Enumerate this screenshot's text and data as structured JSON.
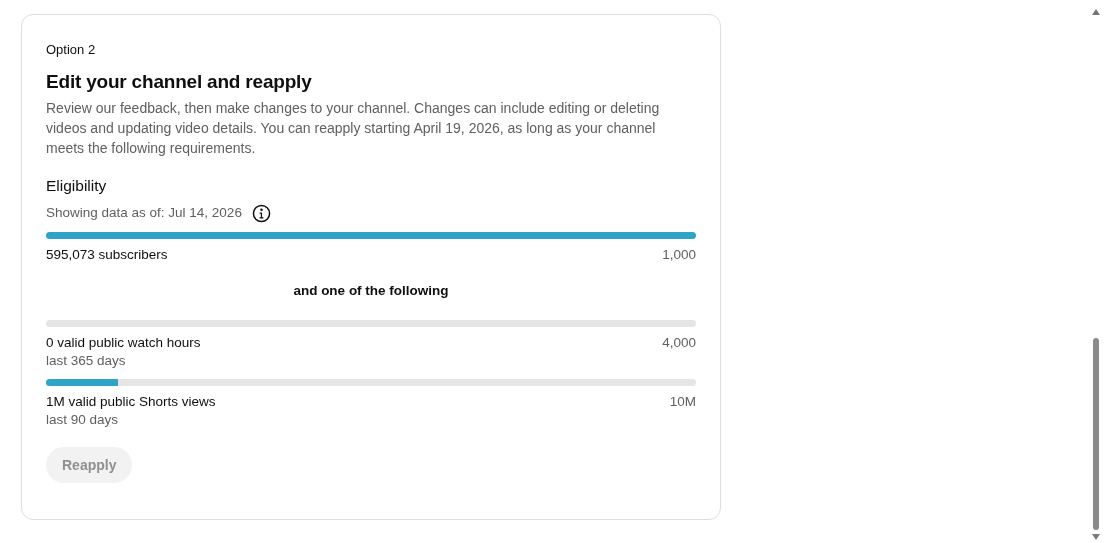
{
  "card": {
    "eyebrow": "Option 2",
    "title": "Edit your channel and reapply",
    "description": "Review our feedback, then make changes to your channel. Changes can include editing or deleting videos and updating video details. You can reapply starting April 19, 2026, as long as your channel meets the following requirements.",
    "section_title": "Eligibility",
    "data_note": "Showing data as of: Jul 14, 2026",
    "requirements": [
      {
        "level": 1.0,
        "label": "595,073 subscribers",
        "target": "1,000"
      },
      {
        "kind": "separator",
        "text": "and one of the following"
      },
      {
        "level": 0.0,
        "label": "0 valid public watch hours",
        "target": "4,000",
        "period": "last 365 days"
      },
      {
        "level": 0.11,
        "label": "1M valid public Shorts views",
        "target": "10M",
        "period": "last 90 days"
      }
    ],
    "button": {
      "label": "Reapply",
      "disabled": true
    }
  }
}
